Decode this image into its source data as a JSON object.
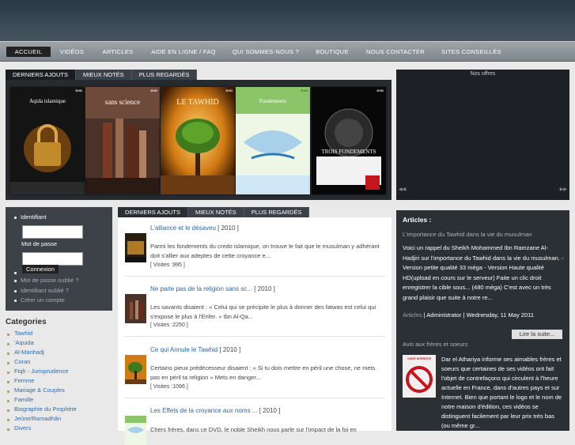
{
  "nav": {
    "items": [
      "ACCUEIL",
      "VIDÉOS",
      "ARTICLES",
      "AIDE EN LIGNE / FAQ",
      "QUI SOMMES-NOUS ?",
      "BOUTIQUE",
      "NOUS CONTACTER",
      "SITES CONSEILLÉS"
    ]
  },
  "featured": {
    "tabs": [
      "DERNIERS AJOUTS",
      "MIEUX NOTÉS",
      "PLUS REGARDÉS"
    ],
    "dvds": [
      {
        "title": "Aqida islamique",
        "colors": [
          "#1b1b1b",
          "#8a5a10",
          "#d1a24a"
        ]
      },
      {
        "title": "sans science",
        "colors": [
          "#3a2a22",
          "#6e4030",
          "#c09070"
        ]
      },
      {
        "title": "LE TAWHID",
        "colors": [
          "#1f1a0a",
          "#d58b1e",
          "#f2c05a"
        ]
      },
      {
        "title": "Fondements",
        "colors": [
          "#e6f2dc",
          "#7bbf62",
          "#2d7ab8"
        ]
      },
      {
        "title": "TROIS FONDEMENTS",
        "colors": [
          "#050505",
          "#3a3a3a",
          "#cfcfcf"
        ]
      }
    ]
  },
  "offers": {
    "title": "Nos offres",
    "prev": "◀◀",
    "next": "▶▶"
  },
  "login": {
    "username_label": "Identifiant",
    "password_label": "Mot de passe",
    "submit_label": "Connexion",
    "forgot_password": "Mot de passe oublié ?",
    "forgot_username": "Identifiant oublié ?",
    "register": "Créer un compte"
  },
  "categories": {
    "title": "Categories",
    "items": [
      "Tawhid",
      "'Aquida",
      "Al-Manhadj",
      "Coran",
      "Fiqh - Jurisprudence",
      "Femme",
      "Mariage & Couples",
      "Famille",
      "Biographie du Prophète",
      "Jeûne/Ramadhân",
      "Divers"
    ]
  },
  "latest": {
    "tabs": [
      "DERNIERS AJOUTS",
      "MIEUX NOTÉS",
      "PLUS REGARDÉS"
    ],
    "items": [
      {
        "title": "L'alliance et le désaveu",
        "year": "[ 2010 ]",
        "text": "Parmi les fondements du credo islamique, on trouve le fait que le musulman y adhérant doit s'allier aux adeptes de cette croyance e...",
        "visits": "[ Visites :995 ]"
      },
      {
        "title": "Ne parle pas de la religion sans sc...",
        "year": "[ 2010 ]",
        "text": "Les savants disaient : « Celui qui se précipite le plus à donner des fatwas est celui qui s'expose le plus à l'Enfer. » Ibn Al-Qa...",
        "visits": "[ Visites :2250 ]"
      },
      {
        "title": "Ce qui Annule le Tawhid",
        "year": "[ 2010 ]",
        "text": "Certains pieux prédécesseur disaient : « Si tu dois mettre en péril une chose, ne mets pas en péril ta religion » Mets en danger...",
        "visits": "[ Visites :1096 ]"
      },
      {
        "title": "Les Effets de la croyance aux noms ...",
        "year": "[ 2010 ]",
        "text": "Chers frères, dans ce DVD, le noble Sheikh nous parle sur l'impact de la foi en",
        "visits": ""
      }
    ]
  },
  "articles": {
    "title": "Articles :",
    "headline": "L'importance du Tawhid dans la vie du musulman",
    "body": "Voici un rappel du Sheikh Mohammed Ibn Ramzane Al-Hadjiri sur l'importance du Tawhid dans la vie du musulman. - Version petite qualité 33 méga - Version Haute qualité HD(upload en cours sur le serveur) Faite un clic droit enregistrer la cible sous... (480 méga) C'est avec un très grand plaisir que suite à notre re...",
    "meta_category": "Articles",
    "meta_author": " | Administrator | Wednesday, 11 May 2011",
    "read_more": "Lire la suite...",
    "second_headline": "Avis aux frères et soeurs",
    "second_body": "Dar el Athariya informe ses aimables frères et soeurs que certaines de ses vidéos ont fait l'objet de contrefaçons qui circulent à l'heure actuelle en France, dans d'autres pays et sur Internet. Bien que portant le logo et le nom de notre maison d'édition, ces vidéos se distinguent facilement par leur prix très bas (ou même gr...",
    "stamp": "COPIE INTERDITE"
  },
  "colors": {
    "link": "#2a66aa",
    "dark_panel": "#262b30",
    "nav": "#858b90",
    "accent_red": "#c4161c"
  }
}
